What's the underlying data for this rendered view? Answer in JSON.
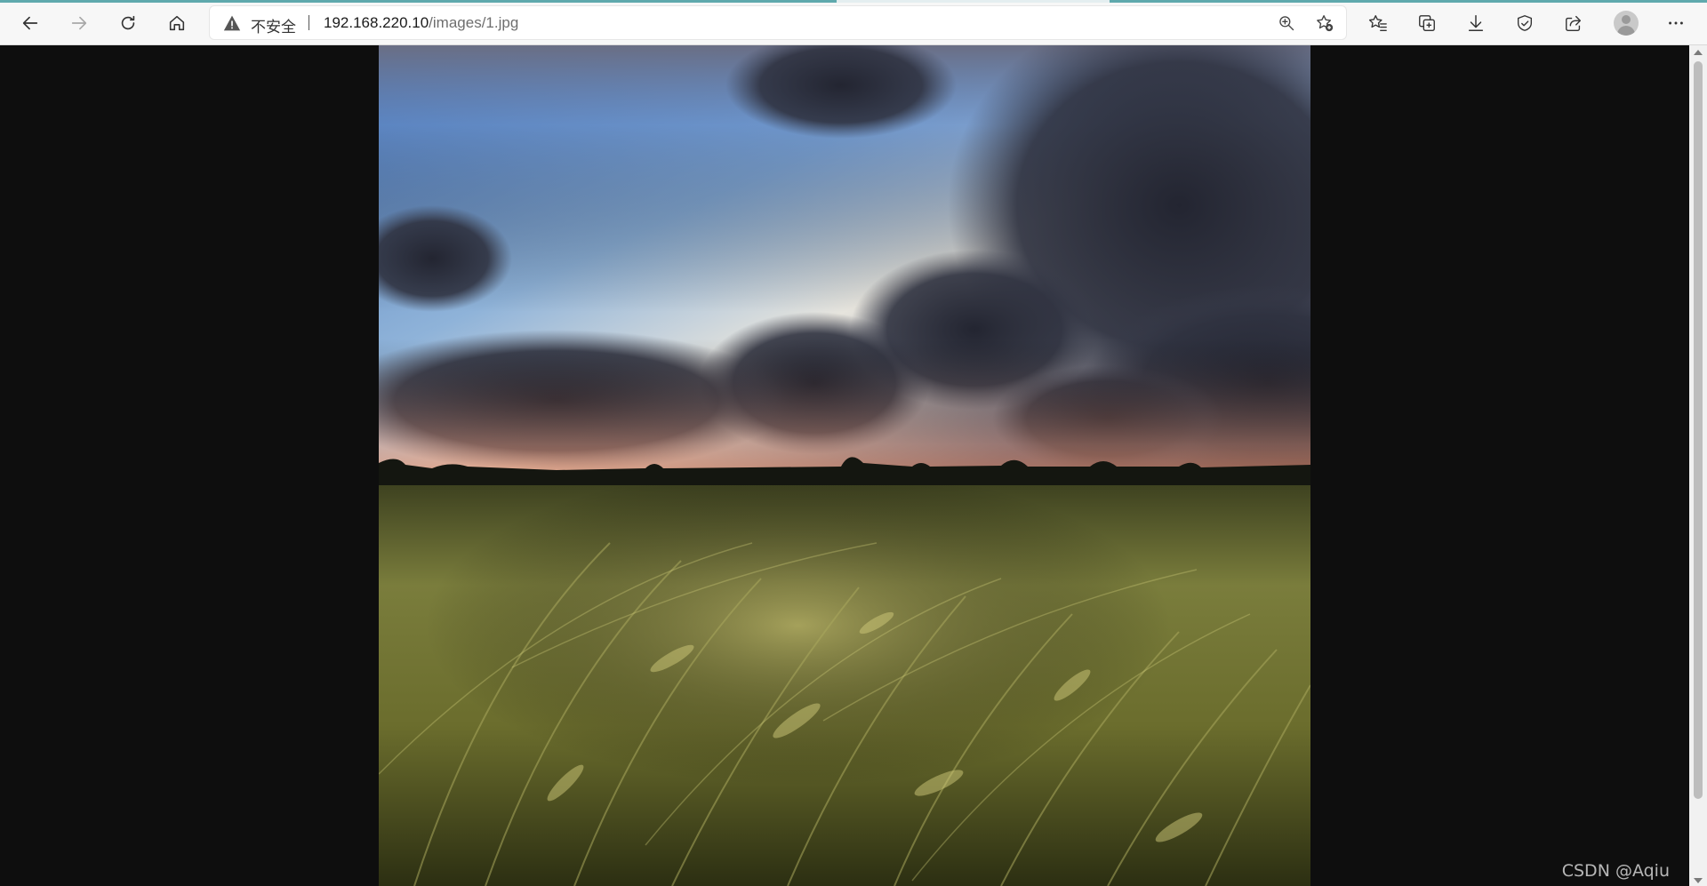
{
  "browser": {
    "security_label": "不安全",
    "url_host": "192.168.220.10",
    "url_path": "/images/1.jpg",
    "nav_icons": [
      "back-icon",
      "forward-icon",
      "refresh-icon",
      "home-icon"
    ],
    "address_bar_icons": [
      "zoom-icon",
      "add-favorite-icon"
    ],
    "toolbar_icons": [
      "favorites-icon",
      "collections-icon",
      "downloads-icon",
      "browser-essentials-icon",
      "share-icon",
      "profile-avatar",
      "more-icon"
    ]
  },
  "content": {
    "image_subject": "wheat-field-under-stormy-sky",
    "watermark": "CSDN @Aqiu"
  },
  "colors": {
    "page_background": "#0e0e0e",
    "toolbar_background": "#f7f7f7",
    "load_bar": "#5fa9ad"
  }
}
